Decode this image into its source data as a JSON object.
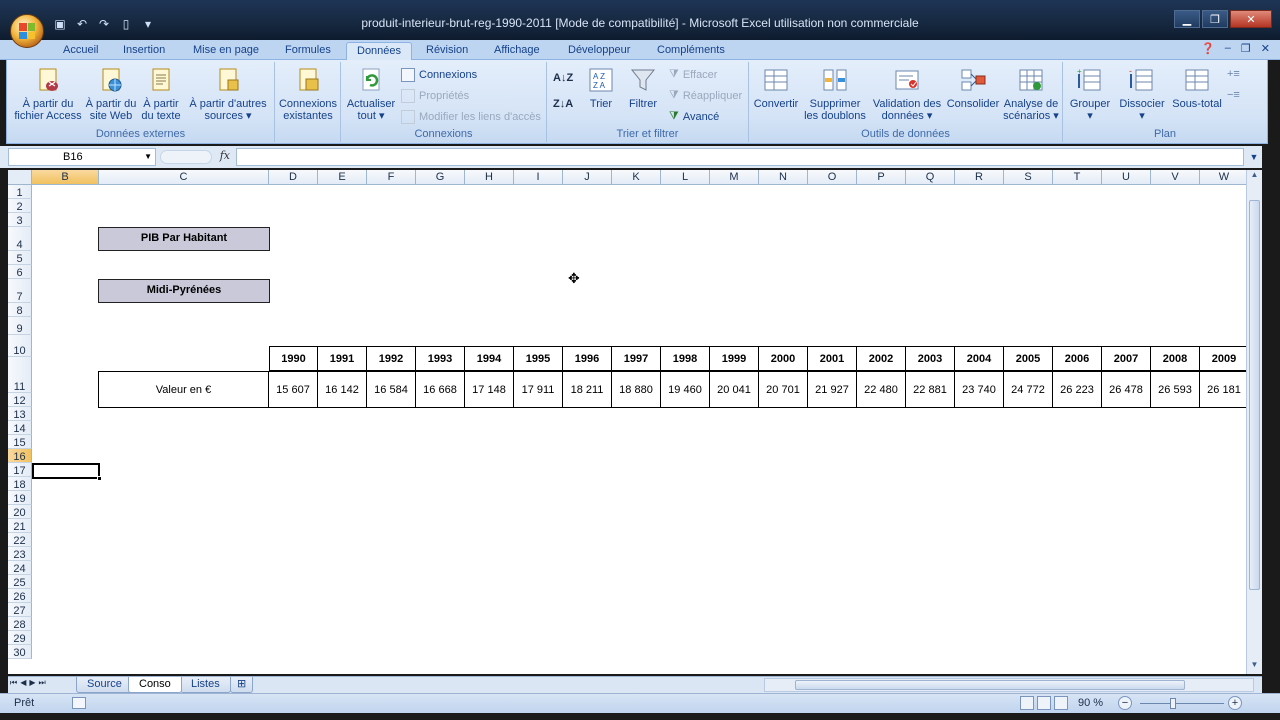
{
  "window": {
    "title": "produit-interieur-brut-reg-1990-2011  [Mode de compatibilité] - Microsoft Excel utilisation non commerciale"
  },
  "ribbon": {
    "tabs": [
      "Accueil",
      "Insertion",
      "Mise en page",
      "Formules",
      "Données",
      "Révision",
      "Affichage",
      "Développeur",
      "Compléments"
    ],
    "active_tab": "Données",
    "groups": {
      "donnees_externes": {
        "label": "Données externes",
        "access": [
          "À partir du",
          "fichier Access"
        ],
        "web": [
          "À partir du",
          "site Web"
        ],
        "texte": [
          "À partir",
          "du texte"
        ],
        "autres": [
          "À partir d'autres",
          "sources"
        ]
      },
      "connexions_existantes": [
        "Connexions",
        "existantes"
      ],
      "connexions": {
        "label": "Connexions",
        "actualiser": [
          "Actualiser",
          "tout"
        ],
        "connexions": "Connexions",
        "proprietes": "Propriétés",
        "modifier_liens": "Modifier les liens d'accès"
      },
      "trier_filtrer": {
        "label": "Trier et filtrer",
        "trier": "Trier",
        "filtrer": "Filtrer",
        "effacer": "Effacer",
        "reappliquer": "Réappliquer",
        "avance": "Avancé"
      },
      "outils": {
        "label": "Outils de données",
        "convertir": "Convertir",
        "supprimer": [
          "Supprimer",
          "les doublons"
        ],
        "validation": [
          "Validation des",
          "données"
        ],
        "consolider": "Consolider",
        "analyse": [
          "Analyse de",
          "scénarios"
        ]
      },
      "plan": {
        "label": "Plan",
        "grouper": "Grouper",
        "dissocier": "Dissocier",
        "sous_total": "Sous-total"
      }
    }
  },
  "formula_bar": {
    "name_box": "B16",
    "fx": "fx",
    "formula": ""
  },
  "sheet": {
    "columns": [
      "B",
      "C",
      "D",
      "E",
      "F",
      "G",
      "H",
      "I",
      "J",
      "K",
      "L",
      "M",
      "N",
      "O",
      "P",
      "Q",
      "R",
      "S",
      "T",
      "U",
      "V",
      "W"
    ],
    "selected_column": "B",
    "rows": [
      "1",
      "2",
      "3",
      "4",
      "5",
      "6",
      "7",
      "8",
      "9",
      "10",
      "11",
      "12",
      "13",
      "14",
      "15",
      "16",
      "17",
      "18",
      "19",
      "20",
      "21",
      "22",
      "23",
      "24",
      "25",
      "26",
      "27",
      "28",
      "29",
      "30"
    ],
    "selected_row": "16",
    "label_pib": "PIB Par Habitant",
    "label_region": "Midi-Pyrénées",
    "row_label": "Valeur en €",
    "years": [
      "1990",
      "1991",
      "1992",
      "1993",
      "1994",
      "1995",
      "1996",
      "1997",
      "1998",
      "1999",
      "2000",
      "2001",
      "2002",
      "2003",
      "2004",
      "2005",
      "2006",
      "2007",
      "2008",
      "2009"
    ],
    "values": [
      "15 607",
      "16 142",
      "16 584",
      "16 668",
      "17 148",
      "17 911",
      "18 211",
      "18 880",
      "19 460",
      "20 041",
      "20 701",
      "21 927",
      "22 480",
      "22 881",
      "23 740",
      "24 772",
      "26 223",
      "26 478",
      "26 593",
      "26 181"
    ]
  },
  "sheet_tabs": [
    "Source",
    "Conso",
    "Listes"
  ],
  "active_sheet": "Conso",
  "status": {
    "mode": "Prêt",
    "zoom": "90 %"
  }
}
